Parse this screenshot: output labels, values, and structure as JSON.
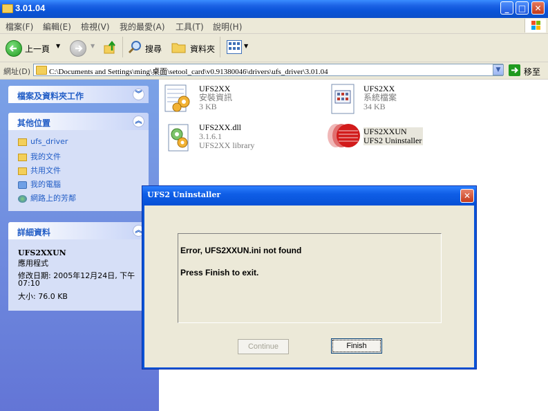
{
  "window": {
    "title": "3.01.04"
  },
  "menu": {
    "items": [
      "檔案(F)",
      "編輯(E)",
      "檢視(V)",
      "我的最愛(A)",
      "工具(T)",
      "說明(H)"
    ]
  },
  "toolbar": {
    "back_label": "上一頁",
    "search_label": "搜尋",
    "folders_label": "資料夾"
  },
  "address": {
    "label": "網址(D)",
    "path": "C:\\Documents and Settings\\ming\\桌面\\setool_card\\v0.91380046\\drivers\\ufs_driver\\3.01.04",
    "go_label": "移至"
  },
  "left_panel": {
    "tasks_title": "檔案及資料夾工作",
    "other_title": "其他位置",
    "other_items": [
      "ufs_driver",
      "我的文件",
      "共用文件",
      "我的電腦",
      "網路上的芳鄰"
    ],
    "details_title": "詳細資料",
    "details": {
      "name": "UFS2XXUN",
      "type": "應用程式",
      "modified_line1": "修改日期: 2005年12月24日, 下午",
      "modified_line2": "07:10",
      "size": "大小: 76.0 KB"
    }
  },
  "files": [
    {
      "name": "UFS2XX",
      "line2": "安裝資訊",
      "line3": "3 KB"
    },
    {
      "name": "UFS2XX",
      "line2": "系統檔案",
      "line3": "34 KB"
    },
    {
      "name": "UFS2XX.dll",
      "line2": "3.1.6.1",
      "line3": "UFS2XX library"
    },
    {
      "name": "UFS2XXUN",
      "line2": "UFS2 Uninstaller"
    }
  ],
  "dialog": {
    "title": "UFS2 Uninstaller",
    "message1": "Error, UFS2XXUN.ini not found",
    "message2": "Press Finish to exit.",
    "continue_label": "Continue",
    "finish_label": "Finish"
  },
  "colors": {
    "xp_blue": "#0a54d8",
    "panel_link": "#215dc6",
    "dialog_face": "#ece9d8"
  }
}
